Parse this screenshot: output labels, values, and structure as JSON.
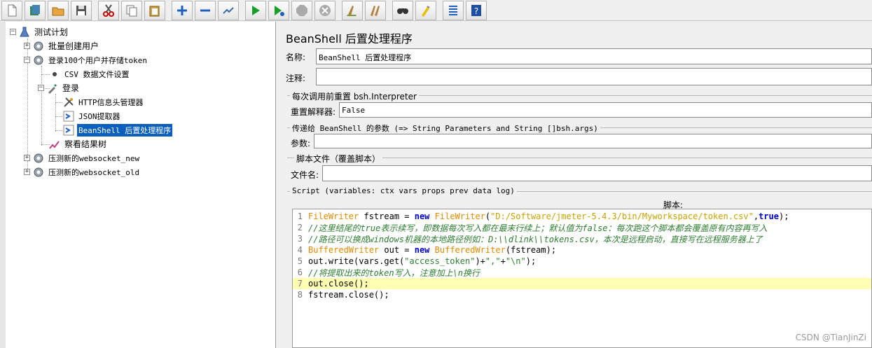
{
  "toolbar": {
    "buttons": [
      "new-icon",
      "templates-icon",
      "open-icon",
      "save-icon",
      "cut-icon",
      "copy-icon",
      "paste-icon",
      "expand-icon",
      "collapse-icon",
      "toggle-icon",
      "start-icon",
      "start-no-pause-icon",
      "stop-icon",
      "shutdown-icon",
      "clear-icon",
      "clear-all-icon",
      "search-icon",
      "reset-search-icon",
      "function-helper-icon",
      "help-icon"
    ]
  },
  "tree": {
    "root": "测试计划",
    "items": [
      {
        "label": "批量创建用户"
      },
      {
        "label": "登录100个用户并存储token"
      },
      {
        "label": "CSV 数据文件设置"
      },
      {
        "label": "登录"
      },
      {
        "label": "HTTP信息头管理器"
      },
      {
        "label": "JSON提取器"
      },
      {
        "label": "BeanShell 后置处理程序"
      },
      {
        "label": "察看结果树"
      },
      {
        "label": "压测新的websocket_new"
      },
      {
        "label": "压测新的websocket_old"
      }
    ]
  },
  "panel": {
    "title": "BeanShell 后置处理程序",
    "name_label": "名称:",
    "name_value": "BeanShell 后置处理程序",
    "comment_label": "注释:",
    "comment_value": "",
    "reset_group": "每次调用前重置 bsh.Interpreter",
    "reset_label": "重置解释器:",
    "reset_value": "False",
    "params_group": "传递给 BeanShell 的参数 (=> String Parameters and String []bsh.args)",
    "params_label": "参数:",
    "params_value": "",
    "file_group": "脚本文件（覆盖脚本）",
    "file_label": "文件名:",
    "file_value": "",
    "script_group": "Script (variables: ctx vars props prev data log)",
    "script_label": "脚本:"
  },
  "script": {
    "line_numbers": [
      "1",
      "2",
      "3",
      "4",
      "5",
      "6",
      "7",
      "8"
    ],
    "l1": {
      "t1": "FileWriter",
      "t2": " fstream = ",
      "kw1": "new",
      "t3": " ",
      "t4": "FileWriter",
      "t5": "(",
      "s1": "\"D:/Software/jmeter-5.4.3/bin/Myworkspace/token.csv\"",
      "t6": ",",
      "kw2": "true",
      "t7": ");"
    },
    "l2": "//这里结尾的true表示续写，即数据每次写入都在最末行续上；默认值为false：每次跑这个脚本都会覆盖原有内容再写入",
    "l3": "//路径可以换成windows机器的本地路径例如：D:\\\\dlink\\\\tokens.csv，本次是远程启动，直接写在远程服务器上了",
    "l4": {
      "t1": "BufferedWriter",
      "t2": " out = ",
      "kw1": "new",
      "t3": " ",
      "t4": "BufferedWriter",
      "t5": "(fstream);"
    },
    "l5": {
      "t1": "out.write(vars.get(",
      "s1": "\"access_token\"",
      "t2": ")+",
      "s2": "\",\"",
      "t3": "+",
      "s3": "\"\\n\"",
      "t4": ");"
    },
    "l6": "//将提取出来的token写入，注意加上\\n换行",
    "l7": "out.close();",
    "l8": "fstream.close();"
  },
  "watermark": "CSDN @TianJinZi"
}
